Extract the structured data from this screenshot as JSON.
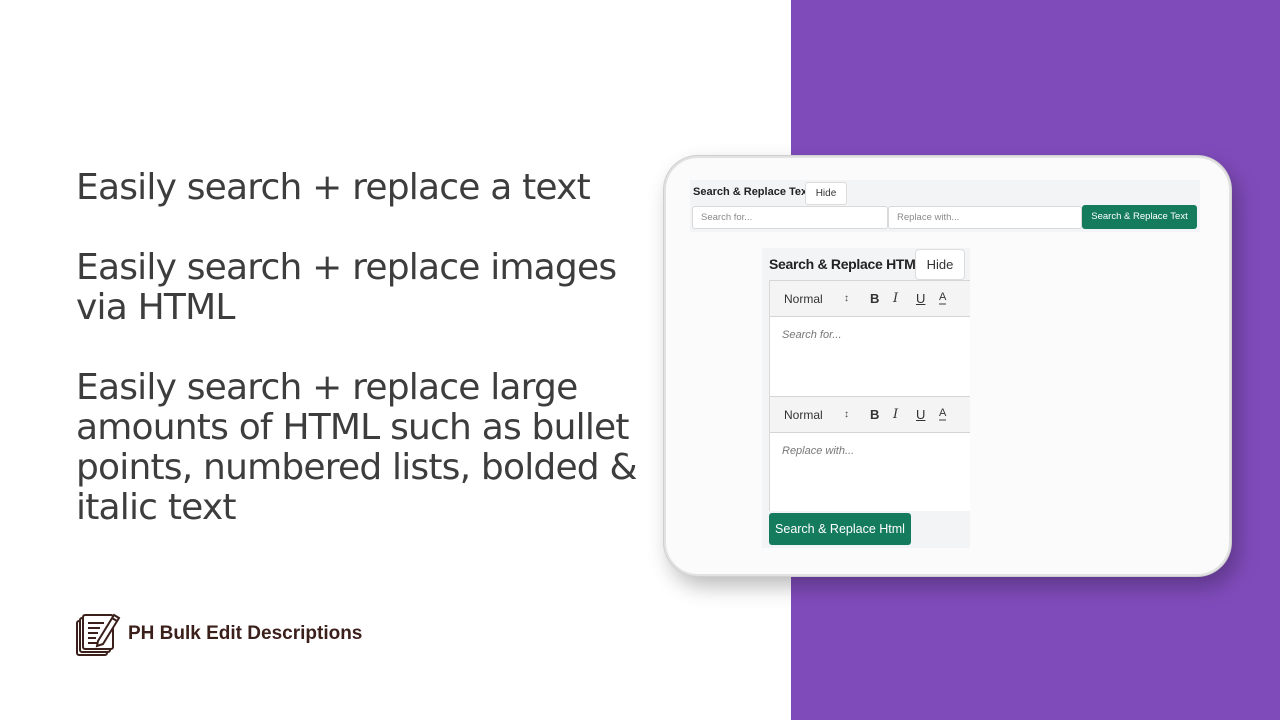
{
  "features": [
    "Easily search + replace a text",
    "Easily search + replace images via HTML",
    "Easily search + replace large amounts of HTML such as bullet points, numbered lists, bolded & italic text"
  ],
  "brand": {
    "name": "PH Bulk Edit Descriptions",
    "icon": "notepad-pencil-icon"
  },
  "colors": {
    "accent_purple": "#7f4bba",
    "button_green": "#147c5c",
    "heading_text": "#3d3d3d",
    "brand_text": "#3b1f1a"
  },
  "text_panel": {
    "title": "Search & Replace Text",
    "hide_label": "Hide",
    "search_placeholder": "Search for...",
    "replace_placeholder": "Replace with...",
    "submit_label": "Search & Replace Text"
  },
  "html_panel": {
    "title": "Search & Replace HTML",
    "hide_label": "Hide",
    "search_editor": {
      "format": "Normal",
      "toolbar": [
        "B",
        "I",
        "U",
        "A"
      ],
      "placeholder": "Search for..."
    },
    "replace_editor": {
      "format": "Normal",
      "toolbar": [
        "B",
        "I",
        "U",
        "A"
      ],
      "placeholder": "Replace with..."
    },
    "submit_label": "Search & Replace Html"
  }
}
